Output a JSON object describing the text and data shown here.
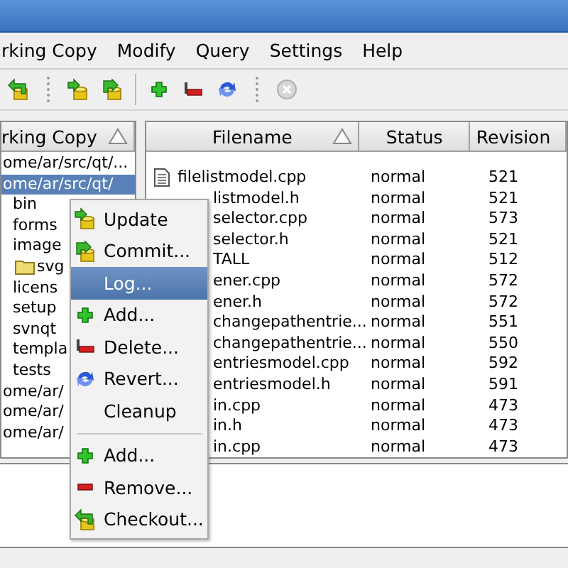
{
  "menu_bar": [
    {
      "label": "rking Copy"
    },
    {
      "label": "Modify"
    },
    {
      "label": "Query"
    },
    {
      "label": "Settings"
    },
    {
      "label": "Help"
    }
  ],
  "toolbars": [
    {
      "groups": [
        [
          {
            "kind": "checkout",
            "disabled": false
          }
        ]
      ]
    },
    {
      "groups": [
        [
          {
            "kind": "update",
            "disabled": false
          },
          {
            "kind": "commit",
            "disabled": false
          }
        ],
        [
          {
            "kind": "add",
            "disabled": false
          },
          {
            "kind": "delete",
            "disabled": false
          },
          {
            "kind": "revert",
            "disabled": false
          }
        ]
      ]
    },
    {
      "groups": [
        [
          {
            "kind": "stop",
            "disabled": true
          }
        ]
      ]
    }
  ],
  "tree": {
    "column": {
      "label": "rking Copy",
      "sorted": true
    },
    "items": [
      {
        "label": "ome/ar/src/qt/...",
        "selected": false
      },
      {
        "label": "ome/ar/src/qt/",
        "selected": true,
        "children": [
          {
            "label": "bin",
            "selected": false
          },
          {
            "label": "forms",
            "selected": false
          },
          {
            "label": "image",
            "selected": false,
            "children": [
              {
                "label": "svg",
                "selected": false
              }
            ]
          },
          {
            "label": "licens",
            "selected": false
          },
          {
            "label": "setup",
            "selected": false
          },
          {
            "label": "svnqt",
            "selected": false
          },
          {
            "label": "templa",
            "selected": false
          },
          {
            "label": "tests",
            "selected": false
          }
        ]
      },
      {
        "label": "ome/ar/",
        "selected": false
      },
      {
        "label": "ome/ar/",
        "selected": false
      },
      {
        "label": "ome/ar/",
        "selected": false
      }
    ]
  },
  "file_list": {
    "columns": [
      {
        "label": "Filename",
        "sorted": true
      },
      {
        "label": "Status",
        "sorted": false
      },
      {
        "label": "Revision",
        "sorted": false
      }
    ],
    "rows": [
      {
        "kind": "file",
        "filename": "filelistmodel.cpp",
        "status": "normal",
        "revision": "521"
      },
      {
        "kind": "fragment",
        "filename": "listmodel.h",
        "status": "normal",
        "revision": "521"
      },
      {
        "kind": "fragment",
        "filename": "selector.cpp",
        "status": "normal",
        "revision": "573"
      },
      {
        "kind": "fragment",
        "filename": "selector.h",
        "status": "normal",
        "revision": "521"
      },
      {
        "kind": "fragment",
        "filename": "TALL",
        "status": "normal",
        "revision": "512"
      },
      {
        "kind": "fragment",
        "filename": "ener.cpp",
        "status": "normal",
        "revision": "572"
      },
      {
        "kind": "fragment",
        "filename": "ener.h",
        "status": "normal",
        "revision": "572"
      },
      {
        "kind": "fragment",
        "filename": "changepathentrie...",
        "status": "normal",
        "revision": "551"
      },
      {
        "kind": "fragment",
        "filename": "changepathentrie...",
        "status": "normal",
        "revision": "550"
      },
      {
        "kind": "fragment",
        "filename": "entriesmodel.cpp",
        "status": "normal",
        "revision": "592"
      },
      {
        "kind": "fragment",
        "filename": "entriesmodel.h",
        "status": "normal",
        "revision": "591"
      },
      {
        "kind": "fragment",
        "filename": "in.cpp",
        "status": "normal",
        "revision": "473"
      },
      {
        "kind": "fragment",
        "filename": "in.h",
        "status": "normal",
        "revision": "473"
      },
      {
        "kind": "fragment",
        "filename": "in.cpp",
        "status": "normal",
        "revision": "473"
      }
    ]
  },
  "context_menu": [
    {
      "kind": "update",
      "label": "Update",
      "selected": false
    },
    {
      "kind": "commit",
      "label": "Commit...",
      "selected": false
    },
    {
      "kind": "plain",
      "label": "Log...",
      "selected": true
    },
    {
      "kind": "add",
      "label": "Add...",
      "selected": false
    },
    {
      "kind": "delete",
      "label": "Delete...",
      "selected": false
    },
    {
      "kind": "revert",
      "label": "Revert...",
      "selected": false
    },
    {
      "kind": "plain",
      "label": "Cleanup",
      "selected": false
    },
    {
      "kind": "separator"
    },
    {
      "kind": "add",
      "label": "Add...",
      "selected": false
    },
    {
      "kind": "remove",
      "label": "Remove...",
      "selected": false
    },
    {
      "kind": "checkout",
      "label": "Checkout...",
      "selected": false
    }
  ]
}
